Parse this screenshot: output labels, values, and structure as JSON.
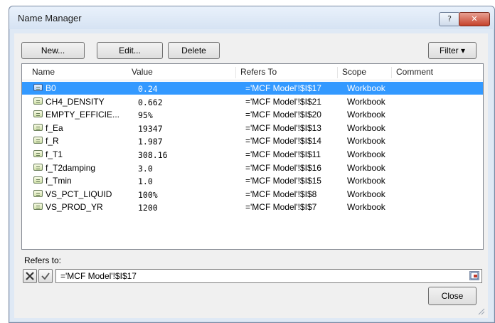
{
  "window": {
    "title": "Name Manager",
    "help_label": "?",
    "close_label": "✕"
  },
  "toolbar": {
    "new_label": "New...",
    "edit_label": "Edit...",
    "delete_label": "Delete",
    "filter_label": "Filter ▾"
  },
  "list": {
    "columns": [
      "Name",
      "Value",
      "Refers To",
      "Scope",
      "Comment"
    ],
    "selected_index": 0,
    "rows": [
      {
        "name": "B0",
        "value": "0.24",
        "refers_to": "='MCF Model'!$I$17",
        "scope": "Workbook",
        "comment": ""
      },
      {
        "name": "CH4_DENSITY",
        "value": "0.662",
        "refers_to": "='MCF Model'!$I$21",
        "scope": "Workbook",
        "comment": ""
      },
      {
        "name": "EMPTY_EFFICIE...",
        "value": "95%",
        "refers_to": "='MCF Model'!$I$20",
        "scope": "Workbook",
        "comment": ""
      },
      {
        "name": "f_Ea",
        "value": "19347",
        "refers_to": "='MCF Model'!$I$13",
        "scope": "Workbook",
        "comment": ""
      },
      {
        "name": "f_R",
        "value": "1.987",
        "refers_to": "='MCF Model'!$I$14",
        "scope": "Workbook",
        "comment": ""
      },
      {
        "name": "f_T1",
        "value": "308.16",
        "refers_to": "='MCF Model'!$I$11",
        "scope": "Workbook",
        "comment": ""
      },
      {
        "name": "f_T2damping",
        "value": "3.0",
        "refers_to": "='MCF Model'!$I$16",
        "scope": "Workbook",
        "comment": ""
      },
      {
        "name": "f_Tmin",
        "value": "1.0",
        "refers_to": "='MCF Model'!$I$15",
        "scope": "Workbook",
        "comment": ""
      },
      {
        "name": "VS_PCT_LIQUID",
        "value": "100%",
        "refers_to": "='MCF Model'!$I$8",
        "scope": "Workbook",
        "comment": ""
      },
      {
        "name": "VS_PROD_YR",
        "value": "1200",
        "refers_to": "='MCF Model'!$I$7",
        "scope": "Workbook",
        "comment": ""
      }
    ]
  },
  "refers": {
    "label": "Refers to:",
    "value": "='MCF Model'!$I$17"
  },
  "footer": {
    "close_label": "Close"
  },
  "colors": {
    "selection": "#3399ff",
    "close_button": "#c5432c"
  }
}
